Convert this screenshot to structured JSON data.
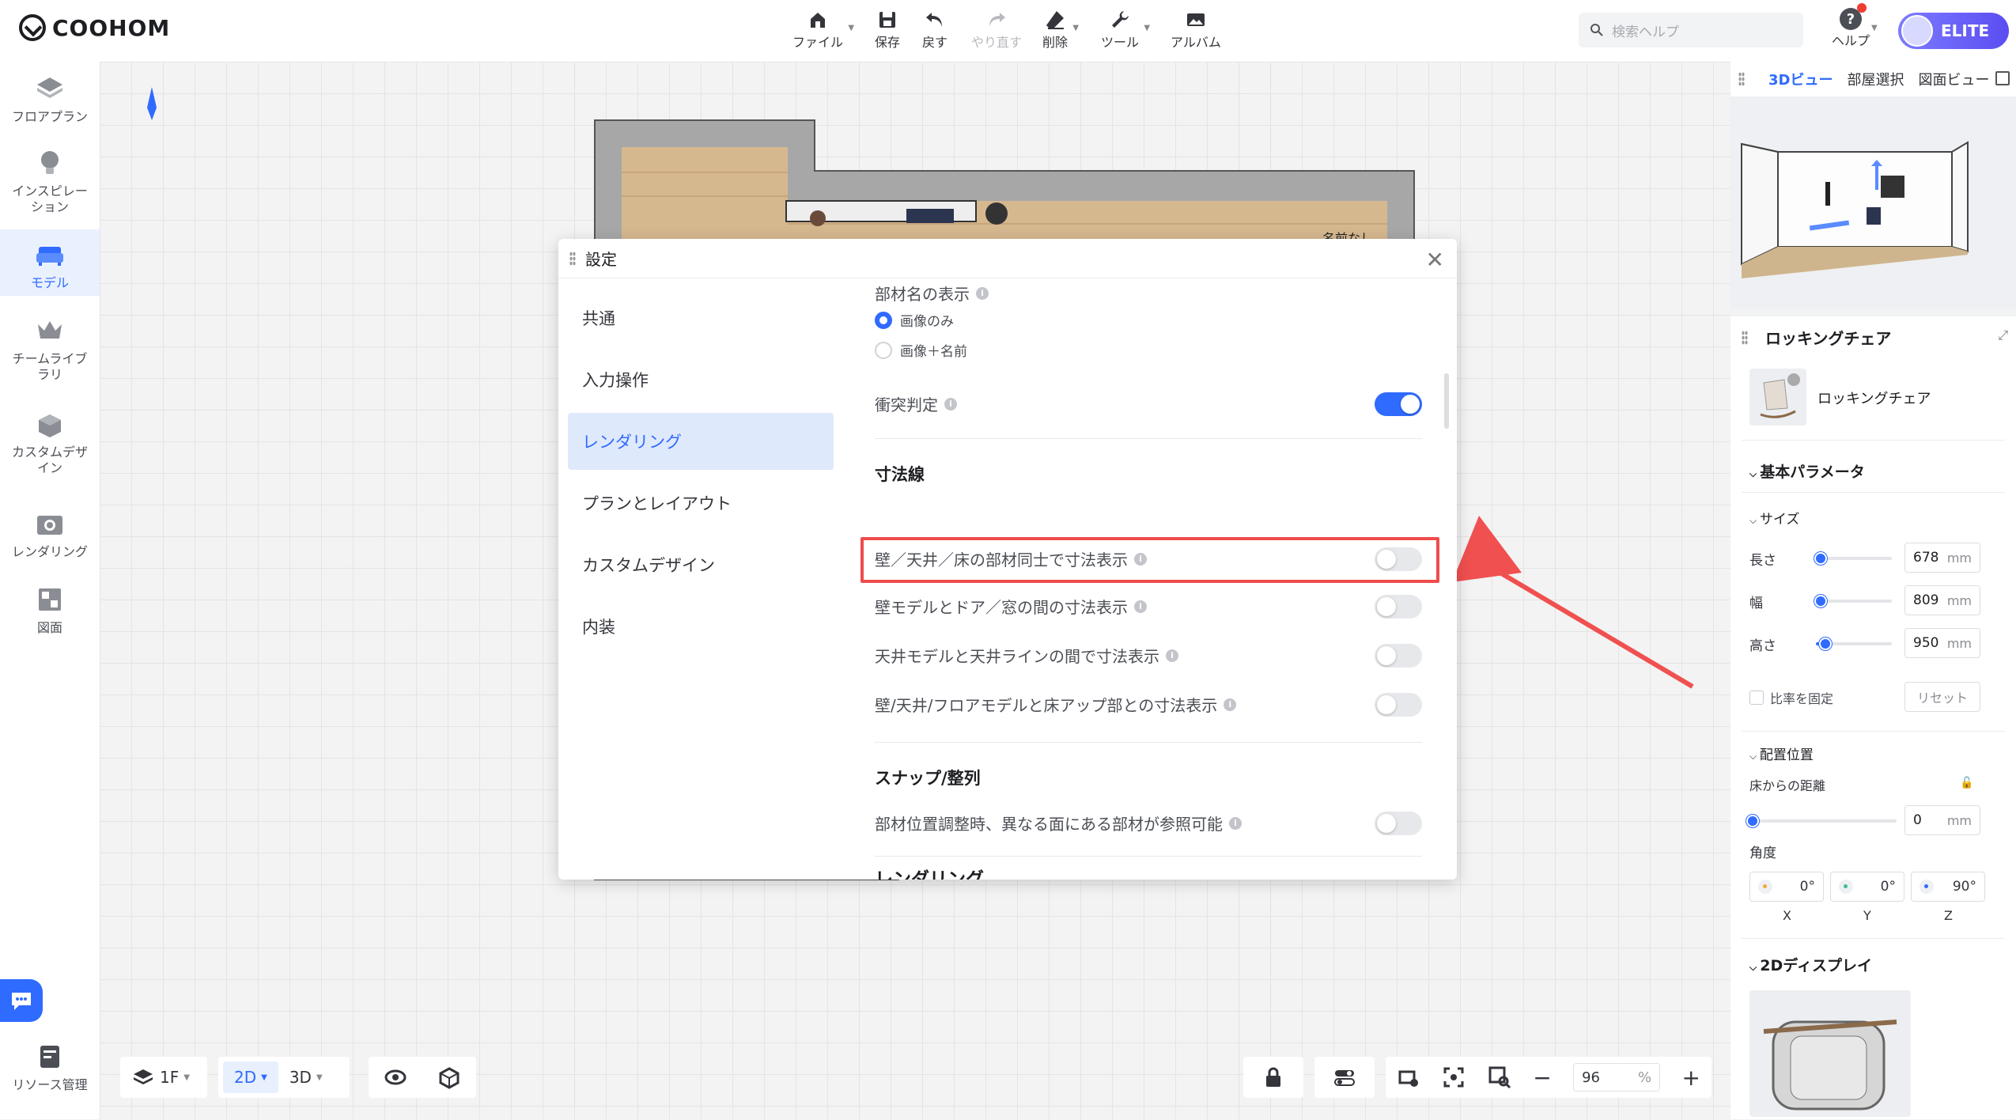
{
  "topbar": {
    "logo": "COOHOM",
    "tools": [
      {
        "label": "ファイル",
        "icon": "home-icon"
      },
      {
        "label": "保存",
        "icon": "save-icon"
      },
      {
        "label": "戻す",
        "icon": "undo-icon"
      },
      {
        "label": "やり直す",
        "icon": "redo-icon"
      },
      {
        "label": "削除",
        "icon": "eraser-icon"
      },
      {
        "label": "ツール",
        "icon": "wrench-icon"
      },
      {
        "label": "アルバム",
        "icon": "album-icon"
      }
    ],
    "search_placeholder": "検索ヘルプ",
    "help_label": "ヘルプ",
    "badge": "ELITE"
  },
  "sidebar": {
    "items": [
      {
        "label": "フロアプラン",
        "icon": "floorplan-icon"
      },
      {
        "label": "インスピレーション",
        "icon": "lightbulb-icon"
      },
      {
        "label": "モデル",
        "icon": "sofa-icon"
      },
      {
        "label": "チームライブラリ",
        "icon": "crown-icon"
      },
      {
        "label": "カスタムデザイン",
        "icon": "custom-box-icon"
      },
      {
        "label": "レンダリング",
        "icon": "camera-icon"
      },
      {
        "label": "図面",
        "icon": "drawing-icon"
      }
    ],
    "resource_label": "リソース管理"
  },
  "canvas": {
    "room_label": "名前なし"
  },
  "settings": {
    "title": "設定",
    "nav": [
      "共通",
      "入力操作",
      "レンダリング",
      "プランとレイアウト",
      "カスタムデザイン",
      "内装"
    ],
    "active_nav": "レンダリング",
    "material_name_label": "部材名の表示",
    "radio_image_only": "画像のみ",
    "radio_image_name": "画像＋名前",
    "collision_label": "衝突判定",
    "collision_on": true,
    "dimension_section": "寸法線",
    "dimension_options": [
      {
        "label": "壁／天井／床の部材同士で寸法表示",
        "on": false
      },
      {
        "label": "壁モデルとドア／窓の間の寸法表示",
        "on": false
      },
      {
        "label": "天井モデルと天井ラインの間で寸法表示",
        "on": false
      },
      {
        "label": "壁/天井/フロアモデルと床アップ部との寸法表示",
        "on": false
      }
    ],
    "snap_section": "スナップ/整列",
    "snap_option": "部材位置調整時、異なる面にある部材が参照可能",
    "rendering_section": "レンダリング"
  },
  "right": {
    "view_tabs": [
      "3Dビュー",
      "部屋選択",
      "図面ビュー"
    ],
    "prop_title": "ロッキングチェア",
    "item_name": "ロッキングチェア",
    "basic_params": "基本パラメータ",
    "size_label": "サイズ",
    "length_label": "長さ",
    "length_value": "678",
    "length_level": 0.06,
    "width_label": "幅",
    "width_value": "809",
    "width_level": 0.06,
    "height_label": "高さ",
    "height_value": "950",
    "height_level": 0.12,
    "unit": "mm",
    "ratio_fix": "比率を固定",
    "reset": "リセット",
    "position_label": "配置位置",
    "floor_distance": "床からの距離",
    "floor_value": "0",
    "angle_label": "角度",
    "angle_x": "0°",
    "angle_y": "0°",
    "angle_z": "90°",
    "axis_x": "X",
    "axis_y": "Y",
    "axis_z": "Z",
    "display_2d": "2Dディスプレイ"
  },
  "bottom": {
    "floor": "1F",
    "mode_2d": "2D",
    "mode_3d": "3D",
    "zoom_value": "96",
    "zoom_unit": "%"
  },
  "colors": {
    "accent": "#2f6bff",
    "highlight": "#ef4d4d",
    "arrow": "#f0504f"
  }
}
